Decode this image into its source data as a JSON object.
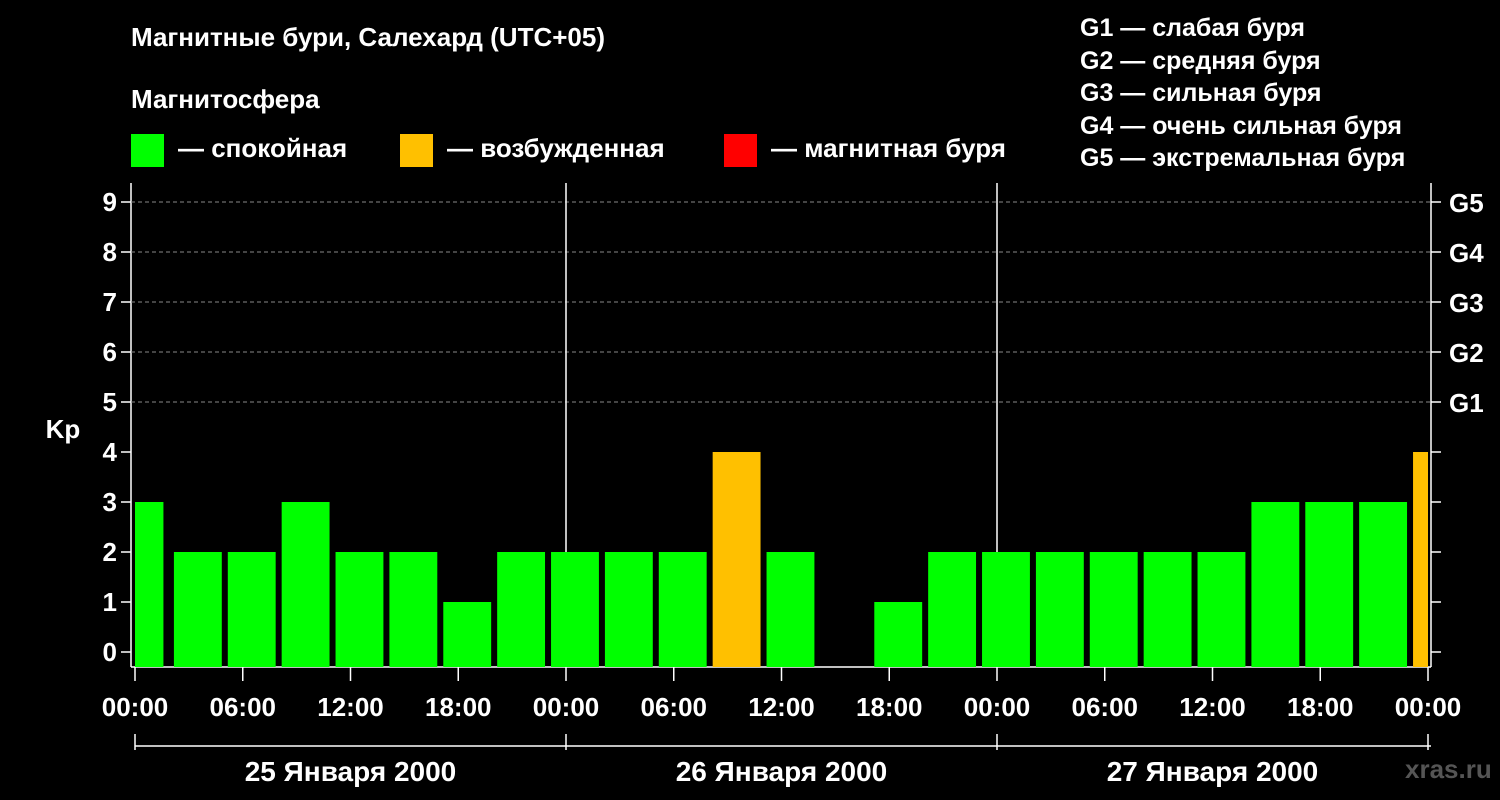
{
  "title": "Магнитные бури, Салехард (UTC+05)",
  "subtitle": "Магнитосфера",
  "legend": [
    {
      "label": "— спокойная",
      "color": "#00ff00"
    },
    {
      "label": "— возбужденная",
      "color": "#ffc000"
    },
    {
      "label": "— магнитная буря",
      "color": "#ff0000"
    }
  ],
  "g_scale": [
    "G1 — слабая буря",
    "G2 — средняя буря",
    "G3 — сильная буря",
    "G4 — очень сильная буря",
    "G5 — экстремальная буря"
  ],
  "watermark": "xras.ru",
  "chart_data": {
    "type": "bar",
    "ylabel": "Kp",
    "ylim": [
      0,
      9
    ],
    "yticks": [
      "0",
      "1",
      "2",
      "3",
      "4",
      "5",
      "6",
      "7",
      "8",
      "9"
    ],
    "right_axis_labels": [
      {
        "kp": 5,
        "label": "G1"
      },
      {
        "kp": 6,
        "label": "G2"
      },
      {
        "kp": 7,
        "label": "G3"
      },
      {
        "kp": 8,
        "label": "G4"
      },
      {
        "kp": 9,
        "label": "G5"
      }
    ],
    "x_tick_labels": [
      "00:00",
      "06:00",
      "12:00",
      "18:00",
      "00:00",
      "06:00",
      "12:00",
      "18:00",
      "00:00",
      "06:00",
      "12:00",
      "18:00",
      "00:00"
    ],
    "days": [
      "25 Января 2000",
      "26 Января 2000",
      "27 Января 2000"
    ],
    "grid": "dashed horizontal at Kp 5–9",
    "bars": [
      {
        "start_hour": 0,
        "end_hour": 1.75,
        "kp": 3,
        "level": "quiet"
      },
      {
        "start_hour": 2,
        "end_hour": 5,
        "kp": 2,
        "level": "quiet"
      },
      {
        "start_hour": 5,
        "end_hour": 8,
        "kp": 2,
        "level": "quiet"
      },
      {
        "start_hour": 8,
        "end_hour": 11,
        "kp": 3,
        "level": "quiet"
      },
      {
        "start_hour": 11,
        "end_hour": 14,
        "kp": 2,
        "level": "quiet"
      },
      {
        "start_hour": 14,
        "end_hour": 17,
        "kp": 2,
        "level": "quiet"
      },
      {
        "start_hour": 17,
        "end_hour": 20,
        "kp": 1,
        "level": "quiet"
      },
      {
        "start_hour": 20,
        "end_hour": 23,
        "kp": 2,
        "level": "quiet"
      },
      {
        "start_hour": 23,
        "end_hour": 26,
        "kp": 2,
        "level": "quiet"
      },
      {
        "start_hour": 26,
        "end_hour": 29,
        "kp": 2,
        "level": "quiet"
      },
      {
        "start_hour": 29,
        "end_hour": 32,
        "kp": 2,
        "level": "quiet"
      },
      {
        "start_hour": 32,
        "end_hour": 35,
        "kp": 4,
        "level": "unsettled"
      },
      {
        "start_hour": 35,
        "end_hour": 38,
        "kp": 2,
        "level": "quiet"
      },
      {
        "start_hour": 38,
        "end_hour": 41,
        "kp": 0,
        "level": "quiet"
      },
      {
        "start_hour": 41,
        "end_hour": 44,
        "kp": 1,
        "level": "quiet"
      },
      {
        "start_hour": 44,
        "end_hour": 47,
        "kp": 2,
        "level": "quiet"
      },
      {
        "start_hour": 47,
        "end_hour": 50,
        "kp": 2,
        "level": "quiet"
      },
      {
        "start_hour": 50,
        "end_hour": 53,
        "kp": 2,
        "level": "quiet"
      },
      {
        "start_hour": 53,
        "end_hour": 56,
        "kp": 2,
        "level": "quiet"
      },
      {
        "start_hour": 56,
        "end_hour": 59,
        "kp": 2,
        "level": "quiet"
      },
      {
        "start_hour": 59,
        "end_hour": 62,
        "kp": 2,
        "level": "quiet"
      },
      {
        "start_hour": 62,
        "end_hour": 65,
        "kp": 3,
        "level": "quiet"
      },
      {
        "start_hour": 65,
        "end_hour": 68,
        "kp": 3,
        "level": "quiet"
      },
      {
        "start_hour": 68,
        "end_hour": 71,
        "kp": 3,
        "level": "quiet"
      },
      {
        "start_hour": 71,
        "end_hour": 72,
        "kp": 4,
        "level": "unsettled"
      }
    ],
    "level_colors": {
      "quiet": "#00ff00",
      "unsettled": "#ffc000",
      "storm": "#ff0000"
    }
  }
}
